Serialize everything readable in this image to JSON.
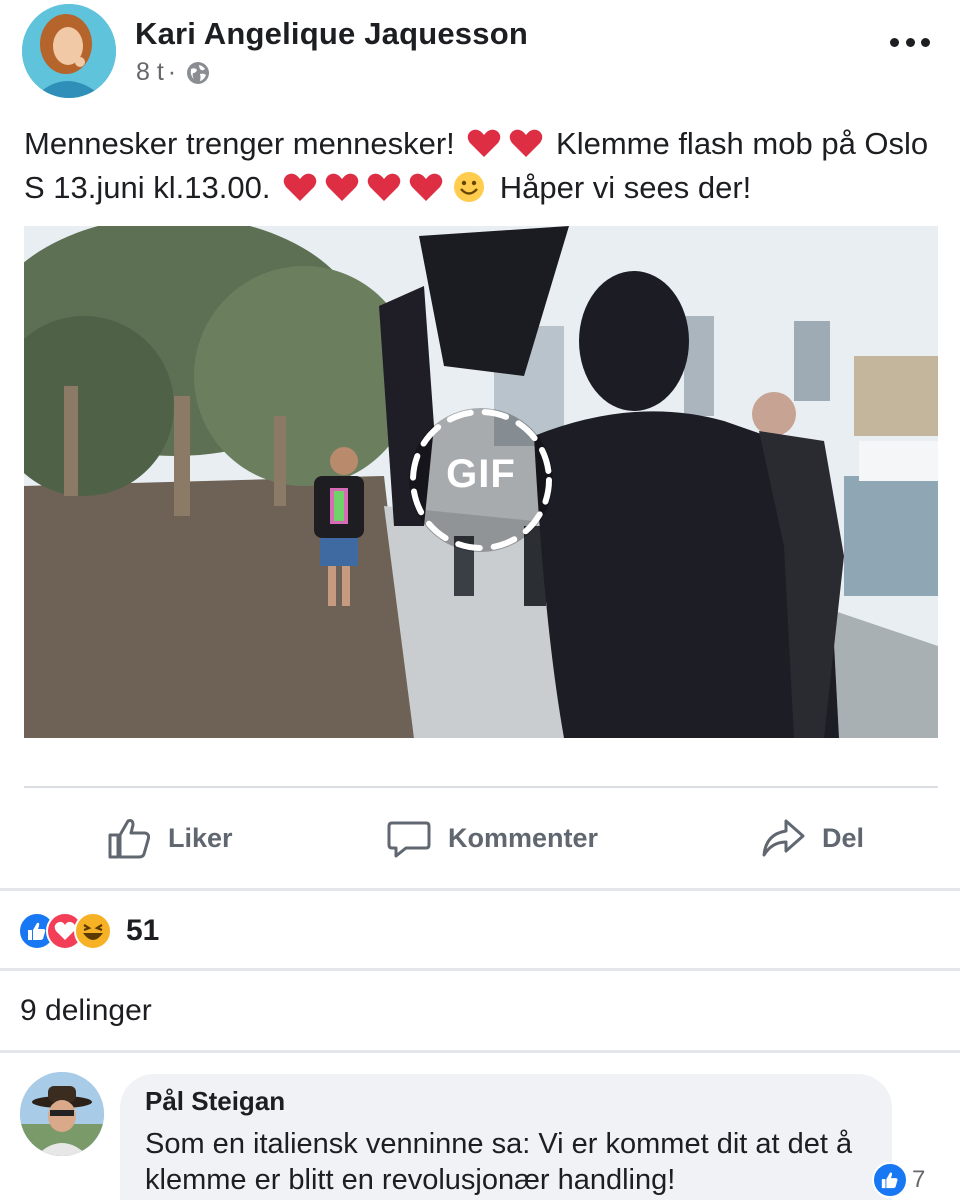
{
  "post": {
    "author": "Kari Angelique Jaquesson",
    "time": "8 t",
    "separator": "·",
    "privacy_icon": "globe-icon",
    "text_part1": "Mennesker trenger mennesker!",
    "text_part2": "Klemme flash mob på Oslo S 13.juni kl.13.00.",
    "text_part3": "Håper vi sees der!",
    "media_badge": "GIF"
  },
  "actions": {
    "like": "Liker",
    "comment": "Kommenter",
    "share": "Del"
  },
  "stats": {
    "reaction_count": "51",
    "reaction_types": [
      "like",
      "love",
      "haha"
    ],
    "shares": "9 delinger"
  },
  "comment": {
    "author": "Pål Steigan",
    "text": "Som en italiensk venninne sa: Vi er kommet dit at det å klemme er blitt en revolusjonær handling!",
    "reaction_count": "7"
  },
  "colors": {
    "like_blue": "#1877f2",
    "love_red": "#f33e58",
    "haha_yellow": "#f7b125",
    "text_primary": "#1c1e21",
    "text_secondary": "#65676b",
    "bubble_bg": "#f0f2f5"
  }
}
